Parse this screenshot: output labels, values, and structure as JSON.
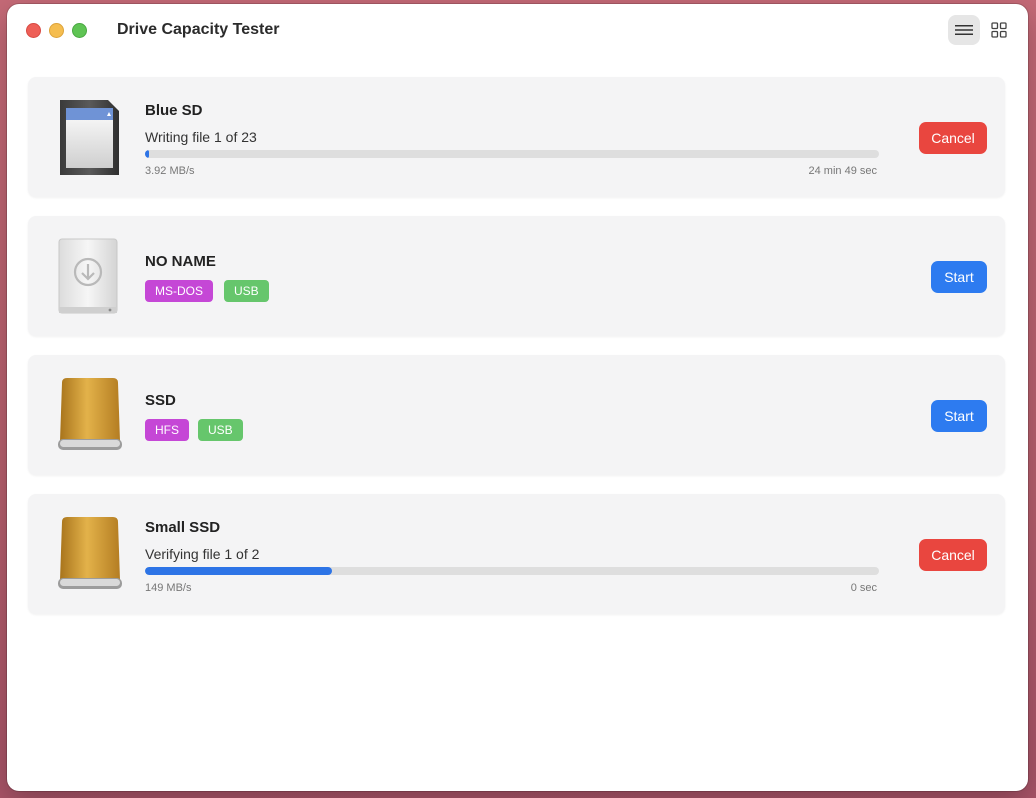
{
  "window": {
    "title": "Drive Capacity Tester"
  },
  "toolbar": {
    "list_view_icon": "list-icon",
    "grid_view_icon": "grid-icon"
  },
  "drives": [
    {
      "name": "Blue SD",
      "icon": "sd-card-icon",
      "state": "writing",
      "status": "Writing file 1 of 23",
      "progress": 0.006,
      "speed": "3.92 MB/s",
      "remaining": "24 min 49 sec",
      "action_label": "Cancel"
    },
    {
      "name": "NO NAME",
      "icon": "external-drive-icon",
      "state": "idle",
      "tags": [
        "MS-DOS",
        "USB"
      ],
      "action_label": "Start"
    },
    {
      "name": "SSD",
      "icon": "ssd-drive-icon",
      "state": "idle",
      "tags": [
        "HFS",
        "USB"
      ],
      "action_label": "Start"
    },
    {
      "name": "Small SSD",
      "icon": "ssd-drive-icon",
      "state": "verifying",
      "status": "Verifying file 1 of 2",
      "progress": 0.255,
      "speed": "149 MB/s",
      "remaining": "0 sec",
      "action_label": "Cancel"
    }
  ],
  "colors": {
    "cancel": "#e9463f",
    "start": "#2d7bf0",
    "progress": "#2d74e6",
    "tag_format": "#c547d6",
    "tag_usb": "#66c66c"
  }
}
